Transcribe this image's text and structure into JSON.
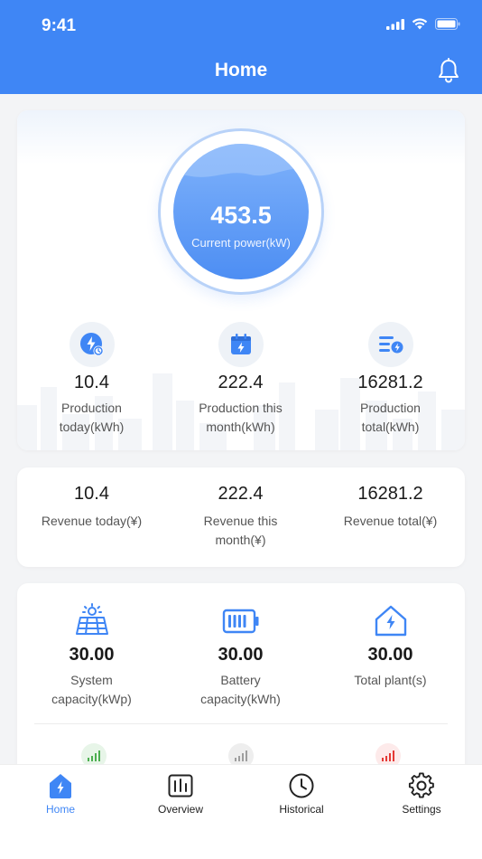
{
  "status_bar": {
    "time": "9:41"
  },
  "header": {
    "title": "Home"
  },
  "power": {
    "value": "453.5",
    "label": "Current power(kW)"
  },
  "production": [
    {
      "value": "10.4",
      "label_line1": "Production",
      "label_line2": "today(kWh)",
      "icon": "bolt-clock-icon"
    },
    {
      "value": "222.4",
      "label_line1": "Production this",
      "label_line2": "month(kWh)",
      "icon": "calendar-bolt-icon"
    },
    {
      "value": "16281.2",
      "label_line1": "Production",
      "label_line2": "total(kWh)",
      "icon": "list-bolt-icon"
    }
  ],
  "revenue": [
    {
      "value": "10.4",
      "label_line1": "Revenue today(¥)",
      "label_line2": ""
    },
    {
      "value": "222.4",
      "label_line1": "Revenue this",
      "label_line2": "month(¥)"
    },
    {
      "value": "16281.2",
      "label_line1": "Revenue total(¥)",
      "label_line2": ""
    }
  ],
  "capacity": [
    {
      "value": "30.00",
      "label_line1": "System",
      "label_line2": "capacity(kWp)",
      "icon": "solar-panel-icon"
    },
    {
      "value": "30.00",
      "label_line1": "Battery",
      "label_line2": "capacity(kWh)",
      "icon": "battery-icon"
    },
    {
      "value": "30.00",
      "label_line1": "Total plant(s)",
      "label_line2": "",
      "icon": "house-bolt-icon"
    }
  ],
  "signal_status_colors": [
    "#4caf50",
    "#9e9e9e",
    "#e53935"
  ],
  "tabs": [
    {
      "label": "Home",
      "icon": "home-bolt-icon",
      "active": true
    },
    {
      "label": "Overview",
      "icon": "chart-icon",
      "active": false
    },
    {
      "label": "Historical",
      "icon": "clock-icon",
      "active": false
    },
    {
      "label": "Settings",
      "icon": "gear-icon",
      "active": false
    }
  ],
  "colors": {
    "primary": "#3f86f5",
    "background": "#f3f4f6"
  }
}
